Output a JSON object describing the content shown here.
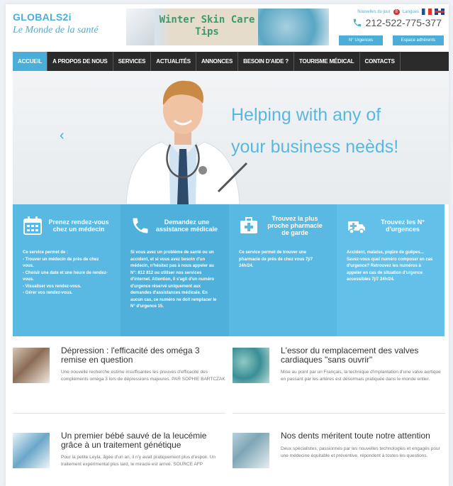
{
  "header": {
    "logo_top": "GLOBALS2i",
    "logo_bottom": "Le Monde de la santé",
    "banner_text": "Winter Skin Care Tips",
    "news_label": "Nouvelles du jour",
    "news_count": "8",
    "lang_label": "Langues",
    "phone": "212-522-775-377",
    "btn_urgences": "N° Urgences",
    "btn_members": "Espace adhérents"
  },
  "nav": {
    "items": [
      "ACCUEIL",
      "A PROPOS DE NOUS",
      "SERVICES",
      "ACTUALITÉS",
      "ANNONCES",
      "BESOIN D'AIDE ?",
      "TOURISME MÉDICAL",
      "CONTACTS"
    ]
  },
  "hero": {
    "title_line1": "Helping with any of",
    "title_line2": "your business neèds!",
    "prev_arrow": "‹"
  },
  "services": [
    {
      "title": "Prenez rendez-vous chez un médecin",
      "icon": "calendar-icon",
      "color": "#59b9e3",
      "lines": [
        "Ce service permet de :",
        "- Trouver un médecin de près de chez vous.",
        "- Choisir une date et une heure de rendez-vous.",
        "- Visualiser vos rendez-vous.",
        "- Gérer vos rendez-vous."
      ]
    },
    {
      "title": "Demandez une assistance médicale",
      "icon": "phone-icon",
      "color": "#4fb0dc",
      "lines": [
        "Si vous avez un problème de santé ou un accident, et si vous avez besoin d'un médecin, n'hésitez pas à nous appeler au N°: 812 812 ou utiliser nos services d'internet. Attention, il s'agit d'un numéro d'urgence réservé uniquement aux demandes d'assistances médicale. En aucun cas, ce numéro ne doit remplacer le N° d'urgence 15."
      ]
    },
    {
      "title": "Trouvez la plus proche pharmacie de garde",
      "icon": "first-aid-kit-icon",
      "color": "#59b9e3",
      "lines": [
        "Ce service permet de trouver une pharmacie de près de chez vous 7j/7 24h/24."
      ]
    },
    {
      "title": "Trouvez les N° d'urgences",
      "icon": "ambulance-icon",
      "color": "#63c0e8",
      "lines": [
        "Accident, malaise, piqûre de guêpes... Savez-vous quel numéro composer en cas d'urgence? Retrouvez les numéros à appeler en cas de situation d'urgence accessibles 7j/7 24h/24."
      ]
    }
  ],
  "articles": [
    {
      "title": "Dépression : l'efficacité des oméga 3 remise en question",
      "desc": "Une nouvelle recherche estime insuffisantes les preuves d'efficacité des compléments oméga 3 lors de dépressions majeures. PAR SOPHIE BARTCZAK"
    },
    {
      "title": "L'essor du remplacement des valves cardiaques \"sans ouvrir\"",
      "desc": "Mise au point par un Français, la technique d'implantation d'une valve aortique en passant par les artères est désormais pratiquée dans le monde entier."
    },
    {
      "title": "Un premier bébé sauvé de la leucémie grâce à un traitement génétique",
      "desc": "Pour la petite Leyla, âgée d'un an, il n'y avait pratiquement plus d'espoir. Un traitement expérimental plus tard, le miracle est arrivé. SOURCE AFP"
    },
    {
      "title": "Nos dents méritent toute notre attention",
      "desc": "Deux spécialistes, passionnés par les nouvelles technologies et engagés pour une médecine équitable et préventive, répondent à toutes les questions."
    }
  ]
}
